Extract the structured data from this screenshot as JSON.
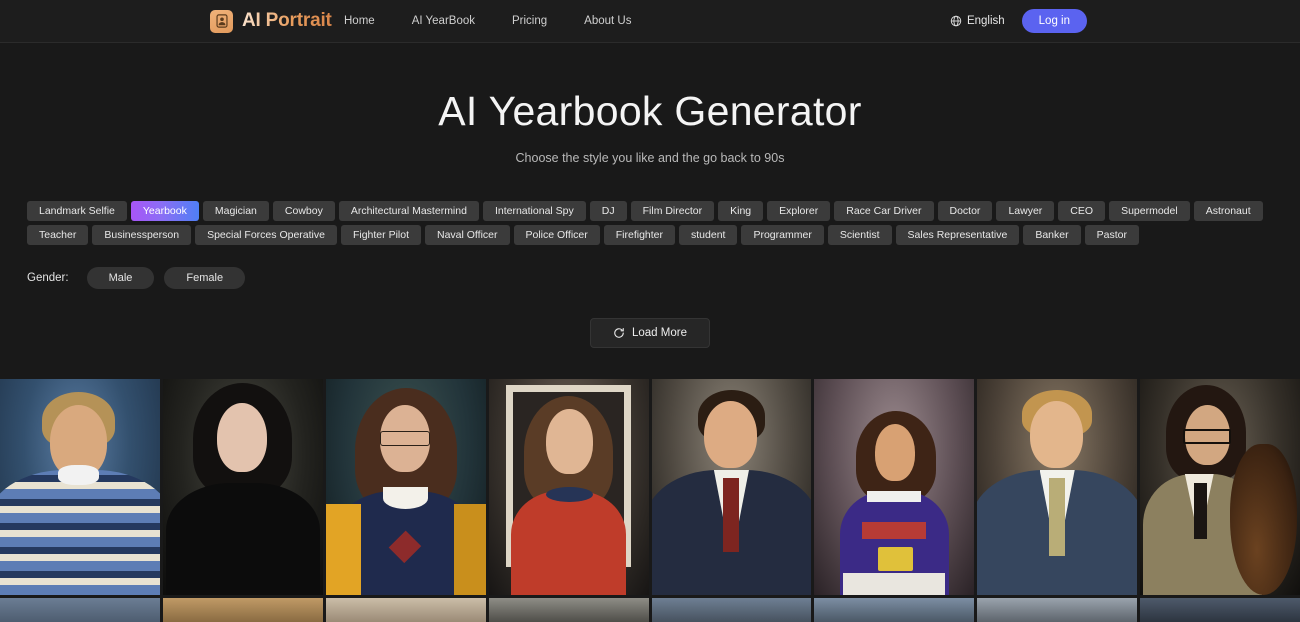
{
  "header": {
    "logo_icon": "person-card-icon",
    "brand": "AI Portrait",
    "nav": [
      {
        "label": "Home"
      },
      {
        "label": "AI YearBook"
      },
      {
        "label": "Pricing"
      },
      {
        "label": "About Us"
      }
    ],
    "language": {
      "icon": "globe-icon",
      "label": "English"
    },
    "login_label": "Log in"
  },
  "hero": {
    "title": "AI Yearbook Generator",
    "subtitle": "Choose the style you like and the go back to 90s"
  },
  "styles": {
    "selected": "Yearbook",
    "tags": [
      "Landmark Selfie",
      "Yearbook",
      "Magician",
      "Cowboy",
      "Architectural Mastermind",
      "International Spy",
      "DJ",
      "Film Director",
      "King",
      "Explorer",
      "Race Car Driver",
      "Doctor",
      "Lawyer",
      "CEO",
      "Supermodel",
      "Astronaut",
      "Teacher",
      "Businessperson",
      "Special Forces Operative",
      "Fighter Pilot",
      "Naval Officer",
      "Police Officer",
      "Firefighter",
      "student",
      "Programmer",
      "Scientist",
      "Sales Representative",
      "Banker",
      "Pastor"
    ]
  },
  "gender": {
    "label": "Gender:",
    "options": [
      "Male",
      "Female"
    ]
  },
  "load_more": {
    "icon": "refresh-icon",
    "label": "Load More"
  },
  "gallery": {
    "row1": [
      {
        "alt": "man-in-patterned-sweater-yearbook-photo"
      },
      {
        "alt": "woman-with-dark-hair-black-top-portrait"
      },
      {
        "alt": "woman-with-glasses-varsity-sweater-portrait"
      },
      {
        "alt": "woman-in-red-sweatshirt-with-mirror-portrait"
      },
      {
        "alt": "young-man-in-navy-suit-red-tie-portrait"
      },
      {
        "alt": "woman-in-purple-basketball-jersey-portrait"
      },
      {
        "alt": "young-man-in-blue-blazer-striped-tie-portrait"
      },
      {
        "alt": "young-man-with-glasses-holding-cello-portrait"
      }
    ],
    "row2": [
      {
        "alt": "partial-photo-1"
      },
      {
        "alt": "partial-photo-2"
      },
      {
        "alt": "partial-photo-3"
      },
      {
        "alt": "partial-photo-4"
      },
      {
        "alt": "partial-photo-5"
      },
      {
        "alt": "partial-photo-6"
      },
      {
        "alt": "partial-photo-7"
      },
      {
        "alt": "partial-photo-8"
      }
    ]
  },
  "colors": {
    "page_bg": "#191919",
    "header_bg": "#1d1d1d",
    "tag_bg": "#3b3b3b",
    "tag_selected_from": "#a855f7",
    "tag_selected_to": "#4f7ff5",
    "login_bg": "#5b63f0",
    "brand_accent": "#e89d5d"
  }
}
